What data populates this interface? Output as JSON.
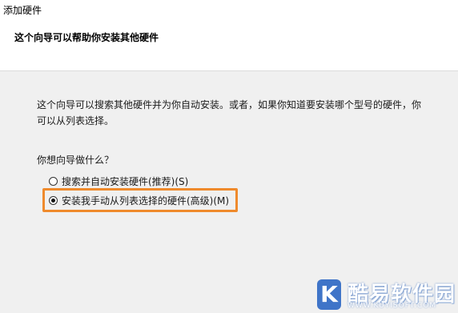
{
  "window": {
    "title": "添加硬件"
  },
  "header": {
    "heading": "这个向导可以帮助你安装其他硬件"
  },
  "content": {
    "description_line1": "这个向导可以搜索其他硬件并为你自动安装。或者，如果你知道要安装哪个型号的硬件，你",
    "description_line2": "可以从列表选择。",
    "question": "你想向导做什么？",
    "options": [
      {
        "label": "搜索并自动安装硬件(推荐)(S)",
        "checked": false
      },
      {
        "label": "安装我手动从列表选择的硬件(高级)(M)",
        "checked": true
      }
    ]
  },
  "highlight": {
    "color": "#ef8a2c"
  },
  "watermark": {
    "letter": "K",
    "name": "酷易软件园",
    "url": "WWW.KUYISOFT.COM",
    "color": "#3f74c8"
  }
}
